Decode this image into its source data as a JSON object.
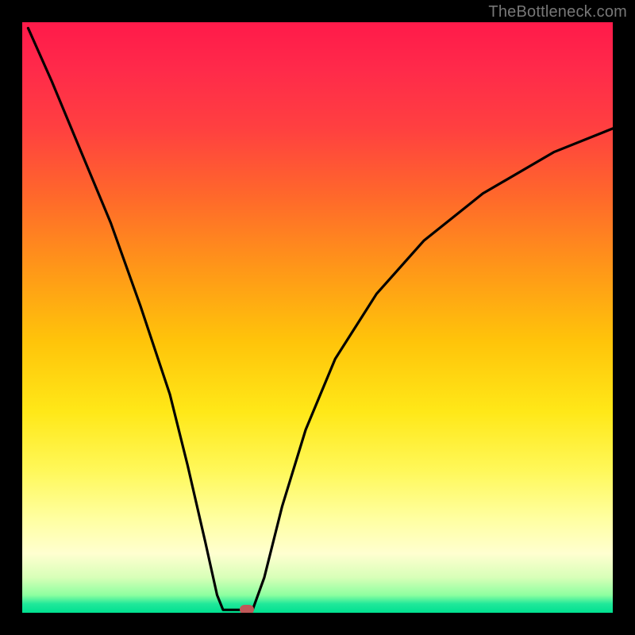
{
  "watermark": "TheBottleneck.com",
  "chart_data": {
    "type": "line",
    "title": "",
    "xlabel": "",
    "ylabel": "",
    "xlim": [
      0,
      100
    ],
    "ylim": [
      0,
      100
    ],
    "curve": {
      "left_branch": [
        {
          "x": 1,
          "y": 99
        },
        {
          "x": 5,
          "y": 90
        },
        {
          "x": 10,
          "y": 78
        },
        {
          "x": 15,
          "y": 66
        },
        {
          "x": 20,
          "y": 52
        },
        {
          "x": 25,
          "y": 37
        },
        {
          "x": 28,
          "y": 25
        },
        {
          "x": 31,
          "y": 12
        },
        {
          "x": 33,
          "y": 3
        },
        {
          "x": 34,
          "y": 0.5
        }
      ],
      "flat_segment": [
        {
          "x": 34,
          "y": 0.5
        },
        {
          "x": 39,
          "y": 0.5
        }
      ],
      "right_branch": [
        {
          "x": 39,
          "y": 0.5
        },
        {
          "x": 41,
          "y": 6
        },
        {
          "x": 44,
          "y": 18
        },
        {
          "x": 48,
          "y": 31
        },
        {
          "x": 53,
          "y": 43
        },
        {
          "x": 60,
          "y": 54
        },
        {
          "x": 68,
          "y": 63
        },
        {
          "x": 78,
          "y": 71
        },
        {
          "x": 90,
          "y": 78
        },
        {
          "x": 100,
          "y": 82
        }
      ]
    },
    "marker": {
      "x": 38,
      "y": 0.5,
      "color": "#c05858"
    },
    "gradient_colors": {
      "top": "#ff1a4a",
      "mid": "#ffe818",
      "bottom": "#00e090"
    }
  }
}
